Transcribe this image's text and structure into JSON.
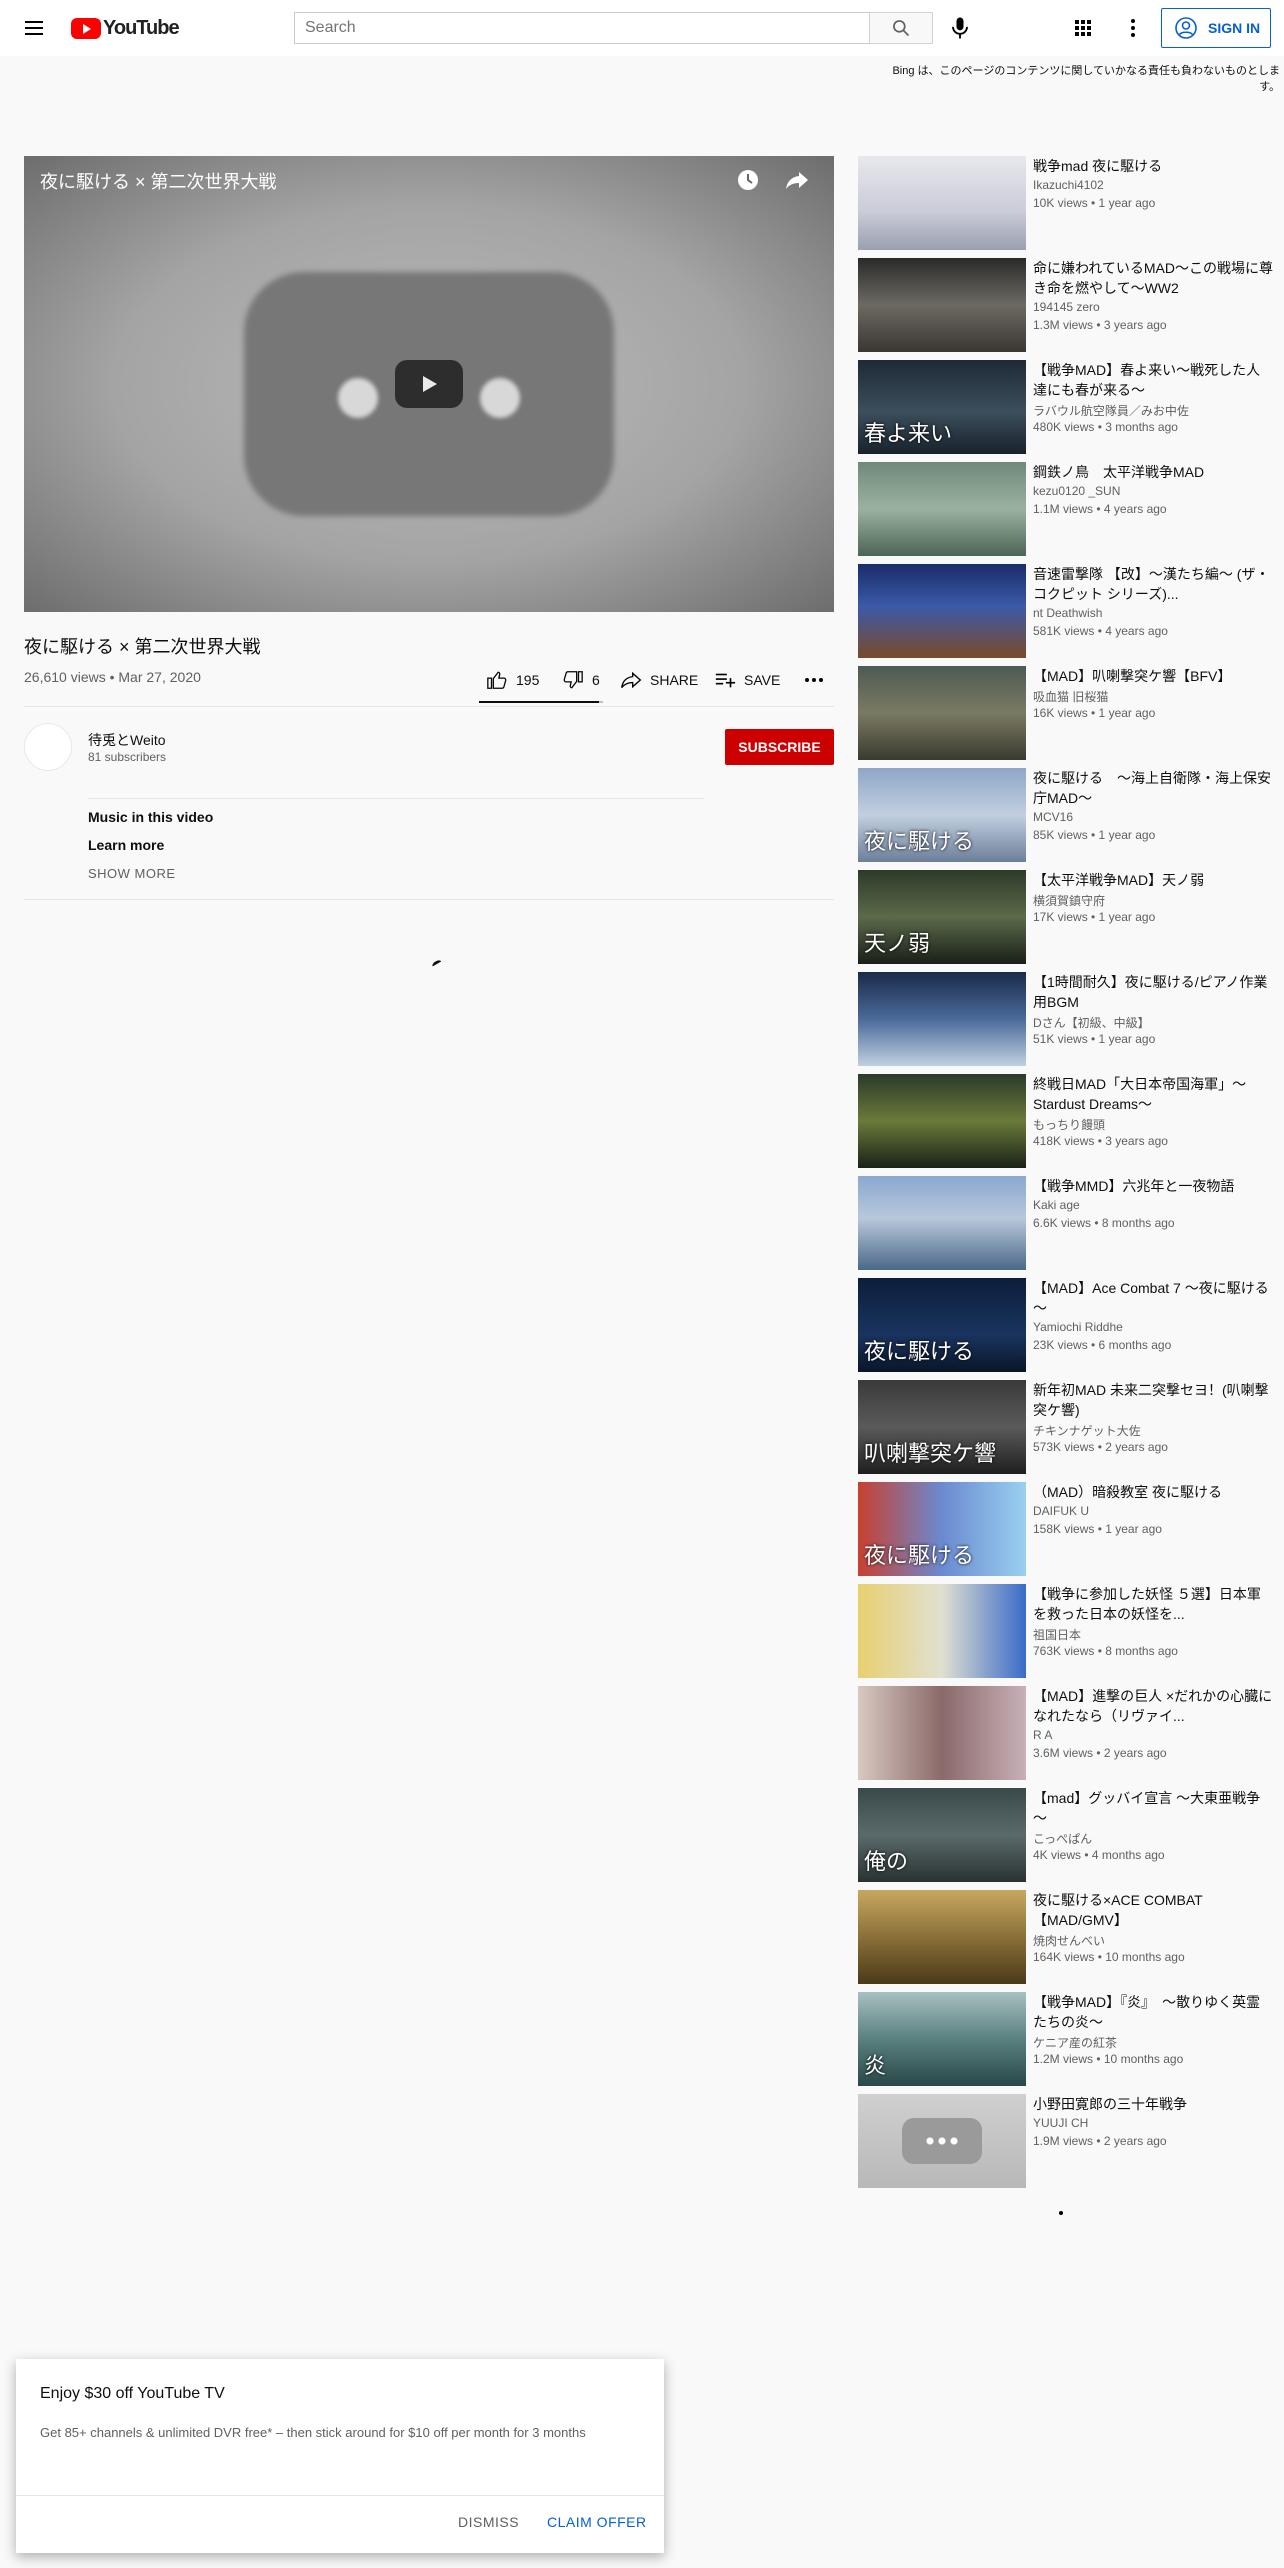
{
  "header": {
    "logo_text": "YouTube",
    "search_placeholder": "Search",
    "signin_label": "SIGN IN"
  },
  "disclaimer": "Bing は、このページのコンテンツに関していかなる責任も負わないものとします。",
  "player": {
    "overlay_title": "夜に駆ける × 第二次世界大戦"
  },
  "video": {
    "title": "夜に駆ける × 第二次世界大戦",
    "meta": "26,610 views • Mar 27, 2020",
    "likes": "195",
    "dislikes": "6",
    "share_label": "SHARE",
    "save_label": "SAVE",
    "like_ratio": 0.97
  },
  "channel": {
    "name": "待兎とWeito",
    "subscribers": "81 subscribers",
    "subscribe_label": "SUBSCRIBE"
  },
  "description": {
    "music_label": "Music in this video",
    "learn_more": "Learn more",
    "show_more": "SHOW MORE"
  },
  "related": [
    {
      "title": "戦争mad 夜に駆ける",
      "channel": "Ikazuchi4102",
      "meta": "10K views • 1 year ago",
      "thumb_bg": "linear-gradient(180deg,#e8e8ee 0%,#c9cbd6 60%,#9aa0b0 100%)",
      "thumb_text": ""
    },
    {
      "title": "命に嫌われているMAD〜この戦場に尊き命を燃やして〜WW2",
      "channel": "194145 zero",
      "meta": "1.3M views • 3 years ago",
      "thumb_bg": "linear-gradient(180deg,#2a2a2a 0%,#6d6a62 50%,#3a3632 100%)",
      "thumb_text": ""
    },
    {
      "title": "【戦争MAD】春よ来い〜戦死した人達にも春が来る〜",
      "channel": "ラバウル航空隊員／みお中佐",
      "meta": "480K views • 3 months ago",
      "thumb_bg": "linear-gradient(180deg,#1e2a36 0%,#3c4e5c 55%,#18222c 100%)",
      "thumb_text": "春よ来い"
    },
    {
      "title": "鋼鉄ノ鳥　太平洋戦争MAD",
      "channel": "kezu0120 _SUN",
      "meta": "1.1M views • 4 years ago",
      "thumb_bg": "linear-gradient(180deg,#6f8a7a 0%,#9bb1a0 50%,#4a6656 100%)",
      "thumb_text": ""
    },
    {
      "title": "音速雷撃隊 【改】～漢たち編～ (ザ・コクピット シリーズ)...",
      "channel": "nt Deathwish",
      "meta": "581K views • 4 years ago",
      "thumb_bg": "linear-gradient(180deg,#1a2c6a 0%,#3b5aa8 45%,#7a4a2a 100%)",
      "thumb_text": ""
    },
    {
      "title": "【MAD】叭喇撃突ケ響【BFV】",
      "channel": "吸血猫 旧桜猫",
      "meta": "16K views • 1 year ago",
      "thumb_bg": "linear-gradient(180deg,#4e5a54 0%,#7a7a62 50%,#3a3a30 100%)",
      "thumb_text": ""
    },
    {
      "title": "夜に駆ける　～海上自衛隊・海上保安庁MAD～",
      "channel": "MCV16",
      "meta": "85K views • 1 year ago",
      "thumb_bg": "linear-gradient(180deg,#8ea6c8 0%,#c2cfe0 50%,#6c7f9a 100%)",
      "thumb_text": "夜に駆ける"
    },
    {
      "title": "【太平洋戦争MAD】天ノ弱",
      "channel": "横須賀鎮守府",
      "meta": "17K views • 1 year ago",
      "thumb_bg": "linear-gradient(180deg,#2e3a2a 0%,#5a6a4a 50%,#1a1f18 100%)",
      "thumb_text": "天ノ弱"
    },
    {
      "title": "【1時間耐久】夜に駆ける/ピアノ作業用BGM",
      "channel": "Dさん【初級、中級】",
      "meta": "51K views • 1 year ago",
      "thumb_bg": "linear-gradient(180deg,#1a2a4a 0%,#4a6a9a 50%,#c0d0e0 100%)",
      "thumb_text": ""
    },
    {
      "title": "終戦日MAD「大日本帝国海軍」〜Stardust Dreams〜",
      "channel": "もっちり饅頭",
      "meta": "418K views • 3 years ago",
      "thumb_bg": "linear-gradient(180deg,#2a3a2a 0%,#6a7a3a 50%,#1a2218 100%)",
      "thumb_text": ""
    },
    {
      "title": "【戦争MMD】六兆年と一夜物語",
      "channel": "Kaki age",
      "meta": "6.6K views • 8 months ago",
      "thumb_bg": "linear-gradient(180deg,#8aa8d0 0%,#b8c8dc 45%,#4a6888 100%)",
      "thumb_text": ""
    },
    {
      "title": "【MAD】Ace Combat 7 ～夜に駆ける～",
      "channel": "Yamiochi Riddhe",
      "meta": "23K views • 6 months ago",
      "thumb_bg": "linear-gradient(180deg,#0c1e3a 0%,#1a3460 60%,#0a1628 100%)",
      "thumb_text": "夜に駆ける"
    },
    {
      "title": "新年初MAD 未来二突撃セヨ！(叭喇撃突ケ響)",
      "channel": "チキンナゲット大佐",
      "meta": "573K views • 2 years ago",
      "thumb_bg": "linear-gradient(180deg,#3a3a3a 0%,#5a5a5a 50%,#1f1f1f 100%)",
      "thumb_text": "叭喇撃突ケ響"
    },
    {
      "title": "（MAD）暗殺教室 夜に駆ける",
      "channel": "DAIFUK U",
      "meta": "158K views • 1 year ago",
      "thumb_bg": "linear-gradient(90deg,#c84030 0%,#6a8ad0 50%,#9ad0f0 100%)",
      "thumb_text": "夜に駆ける"
    },
    {
      "title": "【戦争に参加した妖怪 ５選】日本軍を救った日本の妖怪を...",
      "channel": "祖国日本",
      "meta": "763K views • 8 months ago",
      "thumb_bg": "linear-gradient(90deg,#e8d070 0%,#e0e0d0 50%,#3a6ac8 100%)",
      "thumb_text": ""
    },
    {
      "title": "【MAD】進撃の巨人 ×だれかの心臓になれたなら（リヴァイ...",
      "channel": "R A",
      "meta": "3.6M views • 2 years ago",
      "thumb_bg": "linear-gradient(90deg,#d8c8c0 0%,#8a6a6a 50%,#c8b0b8 100%)",
      "thumb_text": ""
    },
    {
      "title": "【mad】グッバイ宣言 ～大東亜戦争～",
      "channel": "こっぺぱん",
      "meta": "4K views • 4 months ago",
      "thumb_bg": "linear-gradient(180deg,#3a4a4a 0%,#5a6a6a 50%,#2a3232 100%)",
      "thumb_text": "俺の"
    },
    {
      "title": "夜に駆ける×ACE COMBAT【MAD/GMV】",
      "channel": "焼肉せんべい",
      "meta": "164K views • 10 months ago",
      "thumb_bg": "linear-gradient(180deg,#c8a860 0%,#8a7038 50%,#4a3a1a 100%)",
      "thumb_text": ""
    },
    {
      "title": "【戦争MAD】『炎』　〜散りゆく英霊たちの炎〜",
      "channel": "ケニア産の紅茶",
      "meta": "1.2M views • 10 months ago",
      "thumb_bg": "linear-gradient(180deg,#a8c0c0 0%,#5a8080 50%,#2a4848 100%)",
      "thumb_text": "炎"
    },
    {
      "title": "小野田寛郎の三十年戦争",
      "channel": "YUUJI CH",
      "meta": "1.9M views • 2 years ago",
      "thumb_bg": "linear-gradient(180deg,#d0d0d0 0%,#b8b8b8 100%)",
      "thumb_text": ""
    }
  ],
  "promo": {
    "title": "Enjoy $30 off YouTube TV",
    "text": "Get 85+ channels & unlimited DVR free* – then stick around for $10 off per month for 3 months",
    "dismiss_label": "DISMISS",
    "claim_label": "CLAIM OFFER"
  },
  "colors": {
    "brand_red": "#ff0000",
    "subscribe_red": "#cc0000",
    "link_blue": "#065fd4"
  },
  "icons": [
    "menu-icon",
    "search-icon",
    "mic-icon",
    "apps-icon",
    "more-vert-icon",
    "account-icon",
    "watch-later-icon",
    "share-icon",
    "thumb-up-icon",
    "thumb-down-icon",
    "playlist-add-icon",
    "more-horiz-icon"
  ]
}
